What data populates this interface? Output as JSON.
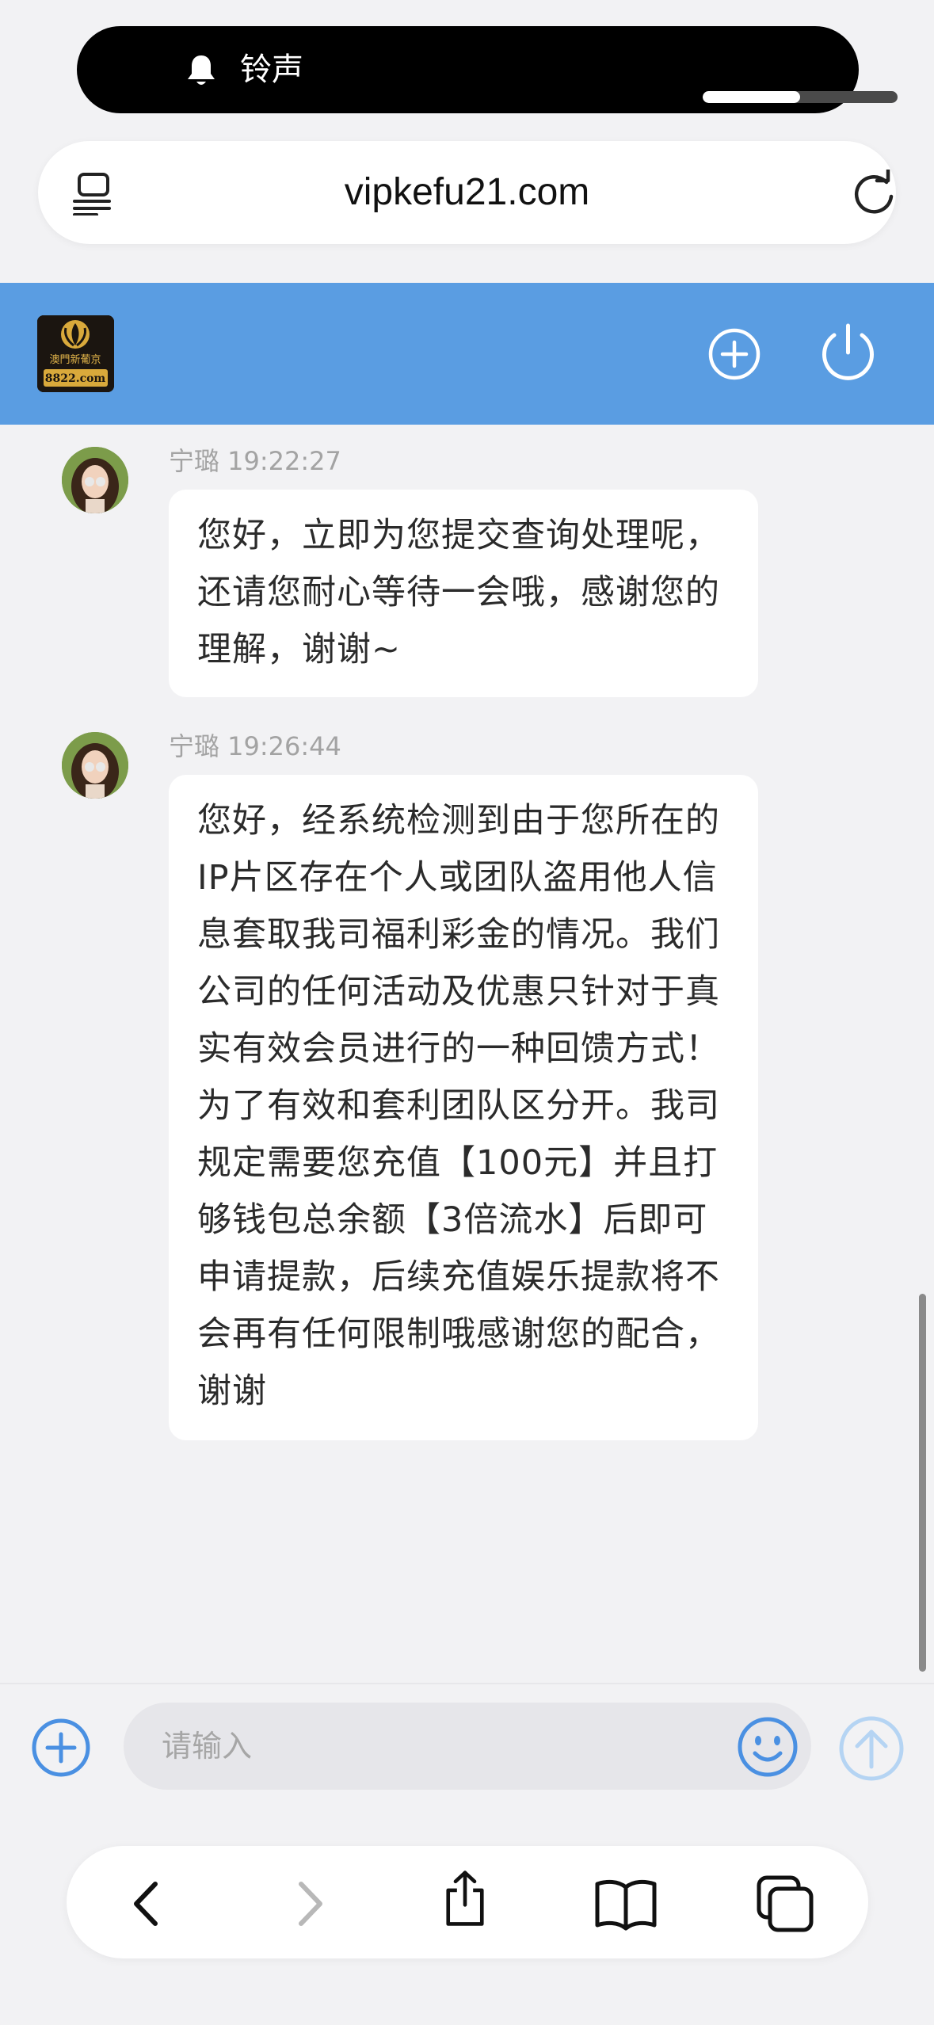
{
  "status": {
    "ringer_label": "铃声",
    "volume_level": 0.5
  },
  "browser": {
    "url": "vipkefu21.com"
  },
  "app": {
    "colors": {
      "header_bg": "#5a9de2",
      "accent": "#4a90e2"
    },
    "logo_text": {
      "line1": "澳門新葡京",
      "line2": "8822.com"
    }
  },
  "messages": [
    {
      "sender": "宁璐",
      "time": "19:22:27",
      "meta": "宁璐 19:22:27",
      "text": "您好，立即为您提交查询处理呢，还请您耐心等待一会哦，感谢您的理解，谢谢~"
    },
    {
      "sender": "宁璐",
      "time": "19:26:44",
      "meta": "宁璐 19:26:44",
      "text": "您好，经系统检测到由于您所在的IP片区存在个人或团队盗用他人信息套取我司福利彩金的情况。我们公司的任何活动及优惠只针对于真实有效会员进行的一种回馈方式！为了有效和套利团队区分开。我司规定需要您充值【100元】并且打够钱包总余额【3倍流水】后即可申请提款，后续充值娱乐提款将不会再有任何限制哦感谢您的配合，谢谢"
    }
  ],
  "composer": {
    "placeholder": "请输入"
  },
  "icons": {
    "ringer": "bell-icon",
    "reader": "reader-mode-icon",
    "reload": "reload-icon",
    "header_add": "plus-circle-icon",
    "header_power": "power-icon",
    "composer_add": "plus-circle-icon",
    "emoji": "emoji-icon",
    "send": "send-arrow-icon",
    "back": "chevron-left-icon",
    "forward": "chevron-right-icon",
    "share": "share-icon",
    "bookmarks": "book-icon",
    "tabs": "tabs-icon"
  }
}
